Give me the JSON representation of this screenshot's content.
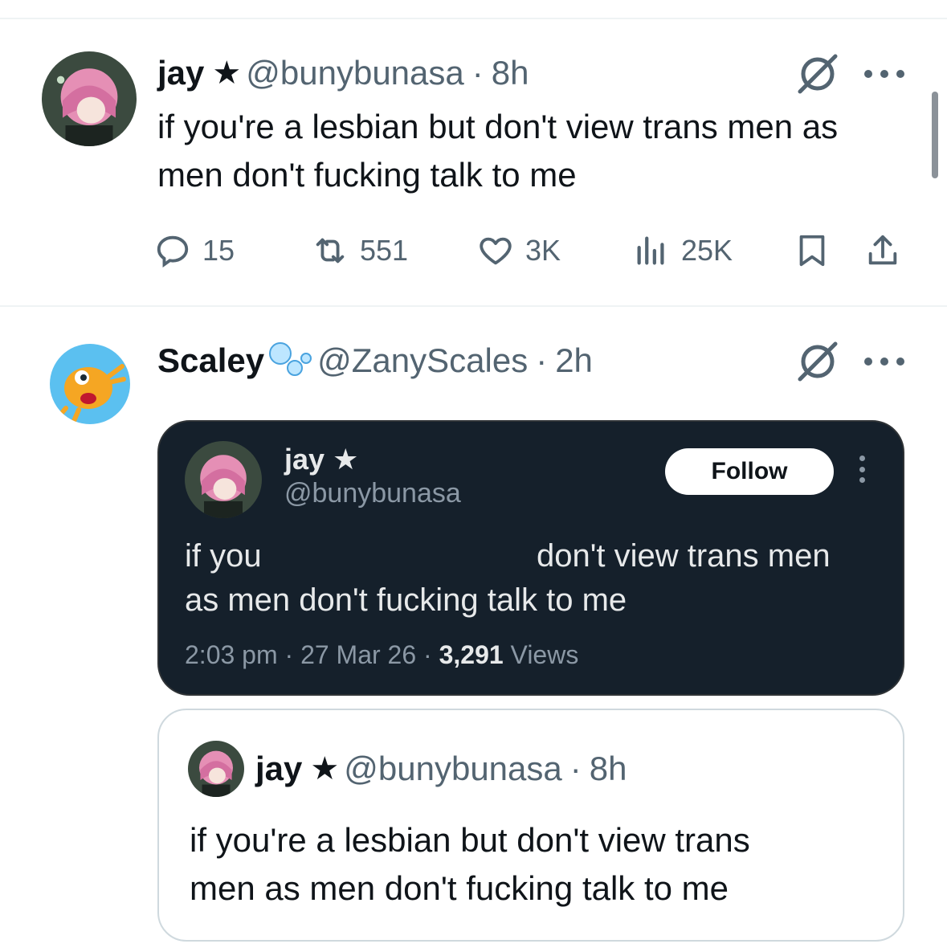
{
  "tweet1": {
    "name": "jay",
    "star": "★",
    "handle": "@bunybunasa",
    "dot": "·",
    "time": "8h",
    "text_line1": "if you're a lesbian but don't view trans men as",
    "text_line2": "men don't fucking talk to me",
    "replies": "15",
    "reposts": "551",
    "likes": "3K",
    "views": "25K"
  },
  "tweet2": {
    "name": "Scaley",
    "handle": "@ZanyScales",
    "dot": "·",
    "time": "2h",
    "screenshot": {
      "name": "jay",
      "star": "★",
      "handle": "@bunybunasa",
      "follow_label": "Follow",
      "text_part1": "if you",
      "text_part2": "don't view trans men",
      "text_line2": "as men don't fucking talk to me",
      "meta_time": "2:03 pm · 27 Mar 26 · ",
      "meta_views_count": "3,291",
      "meta_views_label": " Views"
    },
    "quote": {
      "name": "jay",
      "star": "★",
      "handle": "@bunybunasa",
      "dot": "·",
      "time": "8h",
      "text_line1": "if you're a lesbian but don't view trans",
      "text_line2": "men as men don't fucking talk to me"
    }
  },
  "icons": {
    "reply": "reply-icon",
    "repost": "repost-icon",
    "like": "heart-icon",
    "views": "views-icon",
    "bookmark": "bookmark-icon",
    "share": "share-icon",
    "grok": "grok-icon",
    "more": "more-icon"
  },
  "colors": {
    "text": "#0f1419",
    "secondary": "#536471",
    "dark_bg": "#15202b",
    "border": "#cfd9de"
  }
}
